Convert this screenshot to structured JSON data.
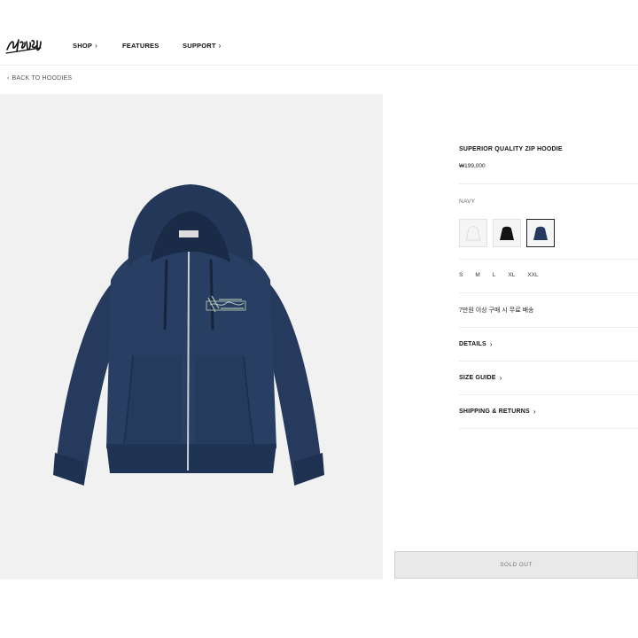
{
  "header": {
    "brand": "Stüssy",
    "nav": [
      {
        "label": "SHOP",
        "icon": "chevron-right-icon"
      },
      {
        "label": "FEATURES"
      },
      {
        "label": "SUPPORT",
        "icon": "chevron-right-icon"
      }
    ]
  },
  "breadcrumb": {
    "back_label": "BACK TO HOODIES",
    "icon": "chevron-left-icon"
  },
  "product": {
    "title": "SUPERIOR QUALITY ZIP HOODIE",
    "price": "₩199,000",
    "selected_color": "NAVY",
    "swatches": [
      {
        "color": "white",
        "hex": "#f4f4f4"
      },
      {
        "color": "black",
        "hex": "#141414"
      },
      {
        "color": "navy",
        "hex": "#243a5e",
        "selected": true
      }
    ],
    "sizes": [
      "S",
      "M",
      "L",
      "XL",
      "XXL"
    ],
    "shipping_notice": "7만원 이상 구매 시 무료 배송",
    "accordions": [
      {
        "label": "DETAILS"
      },
      {
        "label": "SIZE GUIDE"
      },
      {
        "label": "SHIPPING & RETURNS"
      }
    ],
    "cta_label": "SOLD OUT"
  },
  "colors": {
    "navy": "#243a5e",
    "panel_bg": "#f1f1f1",
    "button_bg": "#e9e9e9"
  }
}
